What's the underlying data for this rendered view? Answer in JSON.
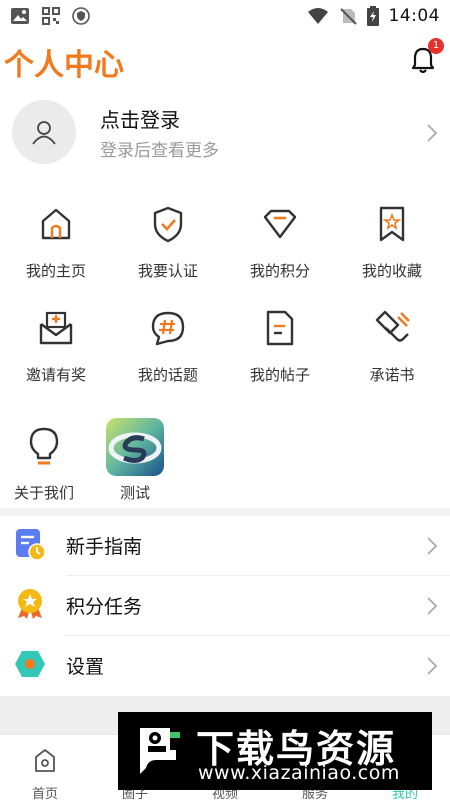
{
  "status_bar": {
    "time": "14:04",
    "icons": [
      "image-icon",
      "grid-app-icon",
      "shield-app-icon",
      "wifi-icon",
      "no-sim-icon",
      "battery-charging-icon"
    ]
  },
  "header": {
    "title": "个人中心",
    "notification_count": "1"
  },
  "login": {
    "title": "点击登录",
    "subtitle": "登录后查看更多"
  },
  "grid": {
    "items": [
      {
        "label": "我的主页",
        "icon": "home-icon"
      },
      {
        "label": "我要认证",
        "icon": "shield-check-icon"
      },
      {
        "label": "我的积分",
        "icon": "diamond-icon"
      },
      {
        "label": "我的收藏",
        "icon": "bookmark-star-icon"
      },
      {
        "label": "邀请有奖",
        "icon": "invite-envelope-icon"
      },
      {
        "label": "我的话题",
        "icon": "topic-hash-icon"
      },
      {
        "label": "我的帖子",
        "icon": "document-icon"
      },
      {
        "label": "承诺书",
        "icon": "pledge-icon"
      },
      {
        "label": "关于我们",
        "icon": "lightbulb-icon"
      },
      {
        "label": "测试",
        "icon": "app-s-icon"
      }
    ]
  },
  "menu": {
    "items": [
      {
        "label": "新手指南",
        "icon": "guide-icon"
      },
      {
        "label": "积分任务",
        "icon": "medal-icon"
      },
      {
        "label": "设置",
        "icon": "settings-hexagon-icon"
      }
    ]
  },
  "bottom_nav": {
    "items": [
      {
        "label": "首页",
        "icon": "home-nav-icon"
      },
      {
        "label": "圈子",
        "icon": "circle-nav-icon"
      },
      {
        "label": "视频",
        "icon": "video-nav-icon"
      },
      {
        "label": "服务",
        "icon": "service-nav-icon"
      },
      {
        "label": "我的",
        "icon": "me-nav-icon"
      }
    ]
  },
  "watermark": {
    "title": "下载鸟资源",
    "url": "www.xiazainiao.com"
  },
  "colors": {
    "accent": "#f07a1d",
    "icon_dark": "#333333",
    "badge": "#e5322d",
    "divider": "#f2f2f2",
    "guide_blue": "#5c7cf4",
    "medal_yellow": "#f5b914",
    "settings_teal": "#34c7b5"
  }
}
